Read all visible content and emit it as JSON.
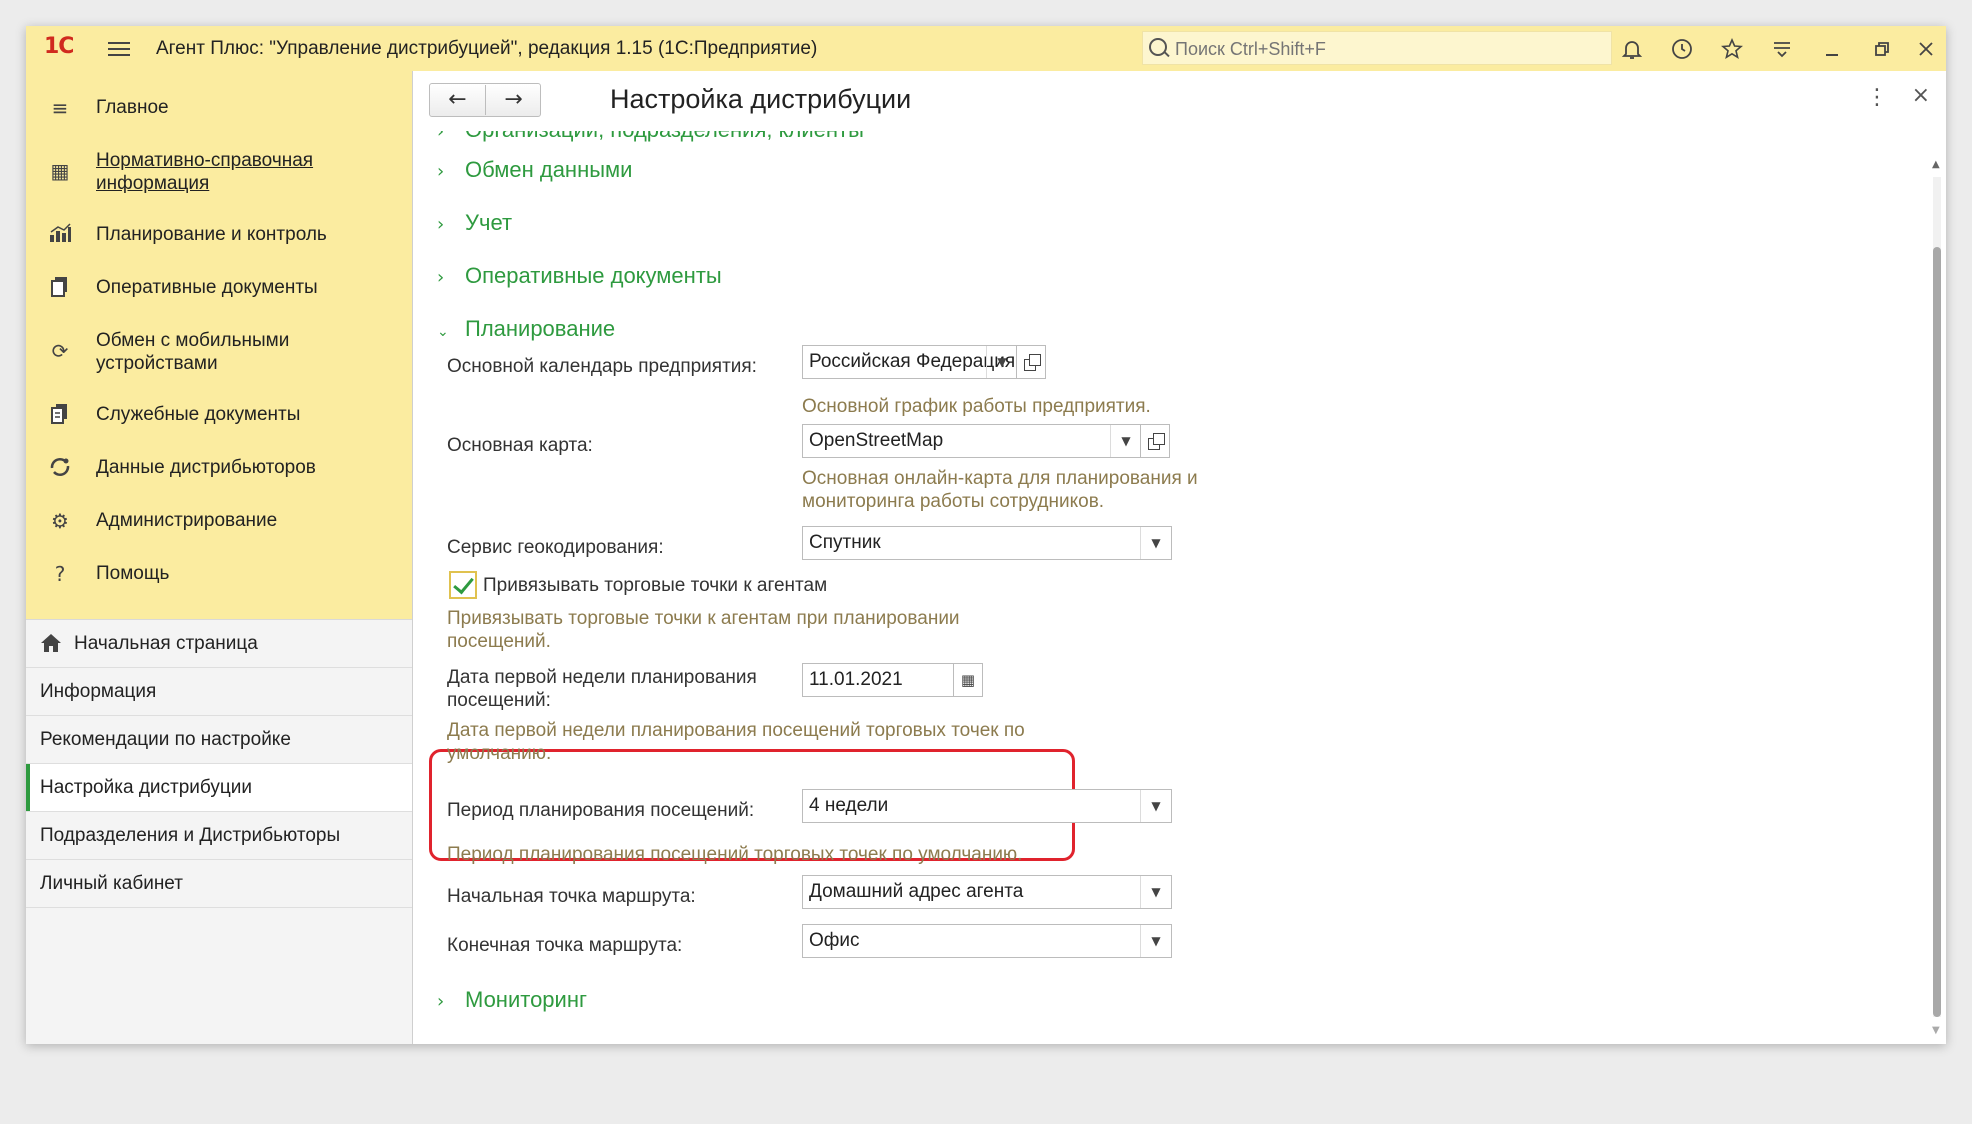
{
  "titlebar": {
    "logo": "1С",
    "app_title": "Агент Плюс: \"Управление дистрибуцией\", редакция 1.15  (1С:Предприятие)",
    "search_placeholder": "Поиск Ctrl+Shift+F"
  },
  "sidebar": {
    "main_items": [
      {
        "label": "Главное",
        "icon": "menu-icon"
      },
      {
        "label": "Нормативно-справочная информация",
        "icon": "grid-icon"
      },
      {
        "label": "Планирование и контроль",
        "icon": "chart-icon"
      },
      {
        "label": "Оперативные документы",
        "icon": "documents-icon"
      },
      {
        "label": "Обмен с мобильными устройствами",
        "icon": "sync-icon"
      },
      {
        "label": "Служебные документы",
        "icon": "service-docs-icon"
      },
      {
        "label": "Данные дистрибьюторов",
        "icon": "distributors-icon"
      },
      {
        "label": "Администрирование",
        "icon": "gear-icon"
      },
      {
        "label": "Помощь",
        "icon": "help-icon"
      }
    ],
    "open_items": [
      {
        "label": "Начальная страница"
      },
      {
        "label": "Информация"
      },
      {
        "label": "Рекомендации по настройке"
      },
      {
        "label": "Настройка дистрибуции"
      },
      {
        "label": "Подразделения и Дистрибьюторы"
      },
      {
        "label": "Личный кабинет"
      }
    ]
  },
  "content": {
    "title": "Настройка дистрибуции",
    "sections": {
      "orgs": "Организации, подразделения, клиенты",
      "exchange": "Обмен данными",
      "accounting": "Учет",
      "operative": "Оперативные документы",
      "planning": "Планирование",
      "monitoring": "Мониторинг"
    },
    "planning": {
      "calendar_label": "Основной календарь предприятия:",
      "calendar_value": "Российская Федерация",
      "calendar_hint": "Основной график работы предприятия.",
      "map_label": "Основная карта:",
      "map_value": "OpenStreetMap",
      "map_hint_1": "Основная онлайн-карта для планирования и",
      "map_hint_2": "мониторинга работы сотрудников.",
      "geocoding_label": "Сервис геокодирования:",
      "geocoding_value": "Спутник",
      "bind_checkbox_label": "Привязывать торговые точки к агентам",
      "bind_checked": true,
      "bind_hint_1": "Привязывать торговые точки к агентам при планировании",
      "bind_hint_2": "посещений.",
      "first_week_label_1": "Дата первой недели планирования",
      "first_week_label_2": "посещений:",
      "first_week_value": "11.01.2021",
      "first_week_hint_1": "Дата первой недели планирования посещений торговых точек по",
      "first_week_hint_2": "умолчанию.",
      "period_label": "Период планирования посещений:",
      "period_value": "4 недели",
      "period_hint": "Период планирования посещений торговых точек по умолчанию.",
      "start_label": "Начальная точка маршрута:",
      "start_value": "Домашний адрес агента",
      "end_label": "Конечная точка маршрута:",
      "end_value": "Офис"
    }
  },
  "colors": {
    "accent_green": "#2e9a3f",
    "panel_yellow": "#fbeca0",
    "hint_brown": "#8c7b4e",
    "highlight_red": "#e0232d"
  }
}
